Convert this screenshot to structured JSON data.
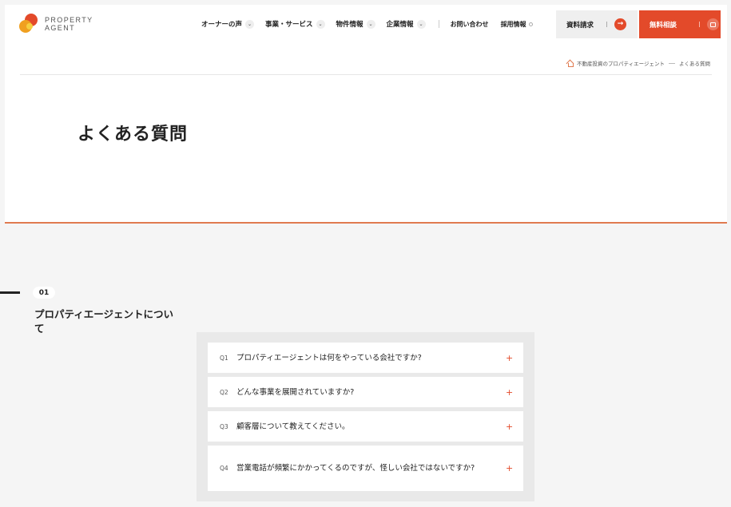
{
  "header": {
    "logo_line1": "PROPERTY",
    "logo_line2": "AGENT",
    "nav": [
      {
        "label": "オーナーの声"
      },
      {
        "label": "事業・サービス"
      },
      {
        "label": "物件情報"
      },
      {
        "label": "企業情報"
      }
    ],
    "contact_label": "お問い合わせ",
    "recruit_label": "採用情報",
    "doc_request_label": "資料請求",
    "consult_label": "無料相談"
  },
  "breadcrumb": {
    "home": "不動産投資のプロパティエージェント",
    "current": "よくある質問"
  },
  "page_title": "よくある質問",
  "section": {
    "number": "01",
    "title": "プロパティエージェントについて"
  },
  "faq": [
    {
      "q": "Q1",
      "text": "プロパティエージェントは何をやっている会社ですか?"
    },
    {
      "q": "Q2",
      "text": "どんな事業を展開されていますか?"
    },
    {
      "q": "Q3",
      "text": "顧客層について教えてください。"
    },
    {
      "q": "Q4",
      "text": "営業電話が頻繁にかかってくるのですが、怪しい会社ではないですか?"
    }
  ],
  "colors": {
    "accent": "#e34a2a",
    "accent_border": "#e07a4f"
  }
}
